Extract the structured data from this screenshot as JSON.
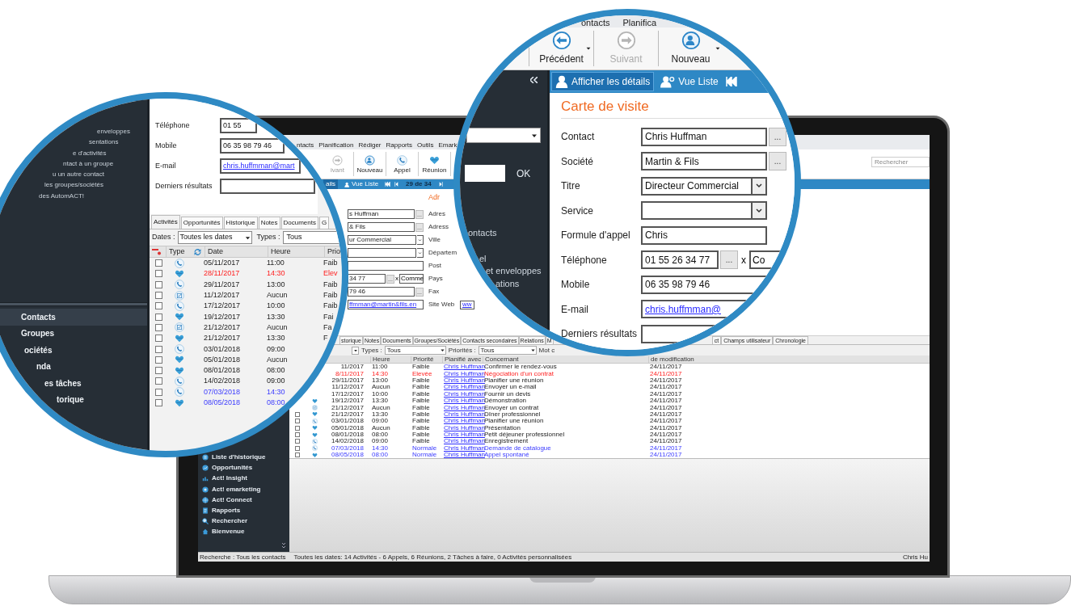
{
  "screen": {
    "menu": [
      "ntacts",
      "Planification",
      "Rédiger",
      "Rapports",
      "Outils",
      "Emark"
    ],
    "toolbar": [
      {
        "label": "ivant",
        "kind": "next",
        "disabled": true
      },
      {
        "label": "Nouveau",
        "kind": "new",
        "disabled": false
      },
      {
        "label": "Appel",
        "kind": "call",
        "disabled": false
      },
      {
        "label": "Réunion",
        "kind": "meeting",
        "disabled": false
      }
    ],
    "search": {
      "placeholder": "Rechercher"
    },
    "view_bar": {
      "tabs": [
        {
          "label": "ails",
          "selected": true
        },
        {
          "label": "Vue Liste",
          "selected": false
        }
      ],
      "counter": "29 de 34"
    },
    "sidebar": [
      {
        "label": "Liste d'historique",
        "kind": "history"
      },
      {
        "label": "Opportunités",
        "kind": "opportunity"
      },
      {
        "label": "Act! Insight",
        "kind": "insight"
      },
      {
        "label": "Act! emarketing",
        "kind": "emarketing"
      },
      {
        "label": "Act! Connect",
        "kind": "connect"
      },
      {
        "label": "Rapports",
        "kind": "report"
      },
      {
        "label": "Rechercher",
        "kind": "search"
      },
      {
        "label": "Bienvenue",
        "kind": "home"
      }
    ],
    "card": {
      "heading": "Adr",
      "fields": [
        {
          "kind": "lookup",
          "value": "s Huffman",
          "button": "..."
        },
        {
          "kind": "lookup",
          "value": "& Fils",
          "button": "..."
        },
        {
          "kind": "select",
          "value": "ur Commercial"
        },
        {
          "kind": "select"
        },
        {
          "kind": "text"
        },
        {
          "kind": "phone",
          "value": "34 77",
          "button": "...",
          "ext_label": "x",
          "ext": "Comme"
        },
        {
          "kind": "lookup",
          "value": "79 46",
          "button": "..."
        },
        {
          "kind": "link",
          "value": "ffmman@martin&fils.en"
        }
      ],
      "address_labels": [
        "Adres",
        "Adress",
        "Ville",
        "Départem",
        "Post",
        "Pays",
        "Fax",
        "Site Web"
      ],
      "website": "ww"
    },
    "tabs_left": [
      "storique",
      "Notes",
      "Documents",
      "Groupes/Sociétés",
      "Contacts secondaires",
      "Relations",
      "M"
    ],
    "tabs_right": [
      "ct",
      "Champs utilisateur",
      "Chronologie"
    ],
    "filters": {
      "types_label": "Types :",
      "types": "Tous",
      "priorities_label": "Priorités :",
      "priorities": "Tous",
      "keyword_label": "Mot c"
    },
    "columns": [
      "Heure",
      "Priorité",
      "Planifié avec",
      "Concernant",
      "de modification"
    ],
    "rows": [
      {
        "date": "11/2017",
        "time": "11:00",
        "priority": "Faible",
        "with": "Chris Huffman",
        "regarding": "Confirmer le rendez-vous",
        "modified": "24/11/2017",
        "highlighted": false,
        "scheduled": false
      },
      {
        "date": "8/11/2017",
        "time": "14:30",
        "priority": "Elevée",
        "with": "Chris Huffman",
        "regarding": "Négociation d'un contrat",
        "modified": "24/11/2017",
        "highlighted": true,
        "scheduled": false
      },
      {
        "date": "29/11/2017",
        "time": "13:00",
        "priority": "Faible",
        "with": "Chris Huffman",
        "regarding": "Planifier une réunion",
        "modified": "24/11/2017",
        "highlighted": false,
        "scheduled": false
      },
      {
        "date": "11/12/2017",
        "time": "Aucun",
        "priority": "Faible",
        "with": "Chris Huffman",
        "regarding": "Envoyer un e-mail",
        "modified": "24/11/2017",
        "highlighted": false,
        "scheduled": false
      },
      {
        "date": "17/12/2017",
        "time": "10:00",
        "priority": "Faible",
        "with": "Chris Huffman",
        "regarding": "Fournir un devis",
        "modified": "24/11/2017",
        "highlighted": false,
        "scheduled": false
      },
      {
        "date": "19/12/2017",
        "time": "13:30",
        "priority": "Faible",
        "with": "Chris Huffman",
        "regarding": "Démonstration",
        "modified": "24/11/2017",
        "highlighted": false,
        "scheduled": false,
        "kind": "meeting"
      },
      {
        "date": "21/12/2017",
        "time": "Aucun",
        "priority": "Faible",
        "with": "Chris Huffman",
        "regarding": "Envoyer un contrat",
        "modified": "24/11/2017",
        "highlighted": false,
        "scheduled": false,
        "kind": "task"
      },
      {
        "date": "21/12/2017",
        "time": "13:30",
        "priority": "Faible",
        "with": "Chris Huffman",
        "regarding": "Dîner professionnel",
        "modified": "24/11/2017",
        "highlighted": false,
        "scheduled": false,
        "kind": "meeting",
        "checked": false
      },
      {
        "date": "03/01/2018",
        "time": "09:00",
        "priority": "Faible",
        "with": "Chris Huffman",
        "regarding": "Planifier une réunion",
        "modified": "24/11/2017",
        "highlighted": false,
        "scheduled": false,
        "kind": "call",
        "checked": false
      },
      {
        "date": "05/01/2018",
        "time": "Aucun",
        "priority": "Faible",
        "with": "Chris Huffman",
        "regarding": "Présentation",
        "modified": "24/11/2017",
        "highlighted": false,
        "scheduled": false,
        "kind": "meeting",
        "checked": false
      },
      {
        "date": "08/01/2018",
        "time": "08:00",
        "priority": "Faible",
        "with": "Chris Huffman",
        "regarding": "Petit déjeuner professionnel",
        "modified": "24/11/2017",
        "highlighted": false,
        "scheduled": false,
        "kind": "meeting",
        "checked": false
      },
      {
        "date": "14/02/2018",
        "time": "09:00",
        "priority": "Faible",
        "with": "Chris Huffman",
        "regarding": "Enregistrement",
        "modified": "24/11/2017",
        "highlighted": false,
        "scheduled": false,
        "kind": "call",
        "checked": false
      },
      {
        "date": "07/03/2018",
        "time": "14:30",
        "priority": "Normale",
        "with": "Chris Huffman",
        "regarding": "Demande de catalogue",
        "modified": "24/11/2017",
        "highlighted": false,
        "scheduled": true,
        "kind": "call",
        "checked": false
      },
      {
        "date": "08/05/2018",
        "time": "08:00",
        "priority": "Normale",
        "with": "Chris Huffman",
        "regarding": "Appel spontané",
        "modified": "24/11/2017",
        "highlighted": false,
        "scheduled": true,
        "kind": "meeting",
        "checked": false
      }
    ],
    "status_bar": [
      "Recherche : Tous les contacts",
      "Toutes les dates: 14 Activités - 6 Appels, 6 Réunions, 2 Tâches à faire, 0 Activités personnalisées",
      "Chris Hu"
    ]
  },
  "left_magnifier": {
    "sidebar_links": [
      "enveloppes",
      "sentations",
      "e d'activités",
      "ntact à un groupe",
      "u un autre contact",
      "les groupes/sociétés",
      "des AutomACT!"
    ],
    "nav": [
      {
        "label": "Contacts",
        "selected": true
      },
      {
        "label": "Groupes",
        "selected": false
      },
      {
        "label": "ociétés",
        "selected": false
      },
      {
        "label": "nda",
        "selected": false
      },
      {
        "label": "es tâches",
        "selected": false
      },
      {
        "label": "torique",
        "selected": false
      }
    ],
    "fields": [
      {
        "label": "Téléphone",
        "kind": "text",
        "value": "01 55"
      },
      {
        "label": "Mobile",
        "kind": "text",
        "value": "06 35 98 79 46"
      },
      {
        "label": "E-mail",
        "kind": "link",
        "value": "chris.huffmman@mart"
      },
      {
        "label": "Derniers résultats",
        "kind": "text"
      }
    ],
    "tabs": [
      {
        "label": "Activités",
        "selected": true
      },
      {
        "label": "Opportunités",
        "selected": false
      },
      {
        "label": "Historique",
        "selected": false
      },
      {
        "label": "Notes",
        "selected": false
      },
      {
        "label": "Documents",
        "selected": false
      },
      {
        "label": "G",
        "selected": false
      }
    ],
    "filters": {
      "dates_label": "Dates :",
      "dates": "Toutes les dates",
      "types_label": "Types :",
      "types": "Tous"
    },
    "columns": [
      "Type",
      "Date",
      "Heure",
      "Prio"
    ],
    "rows": [
      {
        "kind": "call",
        "date": "05/11/2017",
        "time": "11:00",
        "priority": "Faib",
        "highlighted": false,
        "scheduled": false,
        "checked": false
      },
      {
        "kind": "meeting",
        "date": "28/11/2017",
        "time": "14:30",
        "priority": "Elev",
        "highlighted": true,
        "scheduled": false,
        "checked": false
      },
      {
        "kind": "call",
        "date": "29/11/2017",
        "time": "13:00",
        "priority": "Faib",
        "highlighted": false,
        "scheduled": false,
        "checked": false
      },
      {
        "kind": "task",
        "date": "11/12/2017",
        "time": "Aucun",
        "priority": "Faib",
        "highlighted": false,
        "scheduled": false,
        "checked": false
      },
      {
        "kind": "call",
        "date": "17/12/2017",
        "time": "10:00",
        "priority": "Faib",
        "highlighted": false,
        "scheduled": false,
        "checked": false
      },
      {
        "kind": "meeting",
        "date": "19/12/2017",
        "time": "13:30",
        "priority": "Fai",
        "highlighted": false,
        "scheduled": false,
        "checked": false
      },
      {
        "kind": "task",
        "date": "21/12/2017",
        "time": "Aucun",
        "priority": "Fa",
        "highlighted": false,
        "scheduled": false,
        "checked": false
      },
      {
        "kind": "meeting",
        "date": "21/12/2017",
        "time": "13:30",
        "priority": "F",
        "highlighted": false,
        "scheduled": false,
        "checked": false
      },
      {
        "kind": "call",
        "date": "03/01/2018",
        "time": "09:00",
        "highlighted": false,
        "scheduled": false,
        "checked": false
      },
      {
        "kind": "meeting",
        "date": "05/01/2018",
        "time": "Aucun",
        "highlighted": false,
        "scheduled": false,
        "checked": false
      },
      {
        "kind": "meeting",
        "date": "08/01/2018",
        "time": "08:00",
        "highlighted": false,
        "scheduled": false,
        "checked": false
      },
      {
        "kind": "call",
        "date": "14/02/2018",
        "time": "09:00",
        "highlighted": false,
        "scheduled": false,
        "checked": false
      },
      {
        "kind": "call",
        "date": "07/03/2018",
        "time": "14:30",
        "highlighted": false,
        "scheduled": true,
        "checked": false
      },
      {
        "kind": "meeting",
        "date": "08/05/2018",
        "time": "08:00",
        "highlighted": false,
        "scheduled": true,
        "checked": false
      }
    ]
  },
  "right_magnifier": {
    "menu": [
      "ontacts",
      "Planifica"
    ],
    "toolbar": [
      {
        "label": "Précédent",
        "kind": "back",
        "disabled": false,
        "dropdown": true
      },
      {
        "label": "Suivant",
        "kind": "next",
        "disabled": true,
        "dropdown": false
      },
      {
        "label": "Nouveau",
        "kind": "new",
        "disabled": false,
        "dropdown": true
      }
    ],
    "panel": {
      "ok": "OK",
      "links": [
        "ontacts",
        "el",
        "et enveloppes",
        "ations"
      ]
    },
    "view_tabs": [
      {
        "label": "Afficher les détails",
        "selected": true,
        "kind": "details"
      },
      {
        "label": "Vue Liste",
        "selected": false,
        "kind": "list"
      }
    ],
    "card_title": "Carte de visite",
    "fields": [
      {
        "label": "Contact",
        "kind": "lookup",
        "value": "Chris Huffman",
        "button": "..."
      },
      {
        "label": "Société",
        "kind": "lookup",
        "value": "Martin & Fils",
        "button": "..."
      },
      {
        "label": "Titre",
        "kind": "select",
        "value": "Directeur Commercial"
      },
      {
        "label": "Service",
        "kind": "select"
      },
      {
        "label": "Formule d'appel",
        "kind": "text",
        "value": "Chris"
      },
      {
        "label": "Téléphone",
        "kind": "phone",
        "value": "01 55 26 34 77",
        "button": "...",
        "ext_label": "x",
        "ext": "Co"
      },
      {
        "label": "Mobile",
        "kind": "text",
        "value": "06 35 98 79 46"
      },
      {
        "label": "E-mail",
        "kind": "link",
        "value": "chris.huffmman@"
      },
      {
        "label": "Derniers résultats",
        "kind": "text"
      }
    ]
  }
}
